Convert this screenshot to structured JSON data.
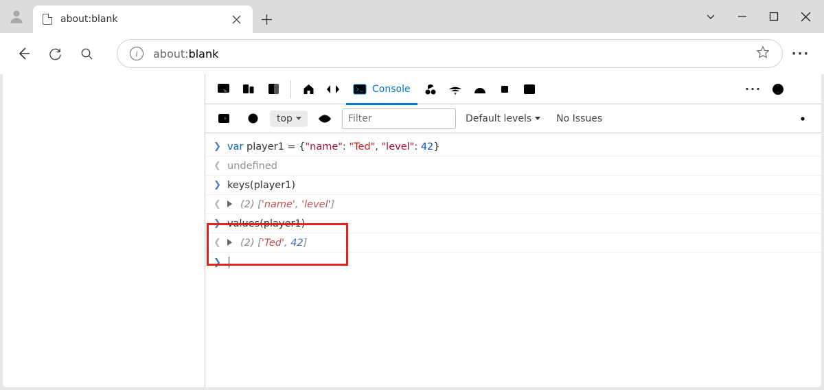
{
  "tab": {
    "title": "about:blank"
  },
  "url": {
    "prefix": "about:",
    "path": "blank"
  },
  "devtools": {
    "active_tab_label": "Console",
    "context": "top",
    "filter_placeholder": "Filter",
    "levels_label": "Default levels",
    "issues_label": "No Issues"
  },
  "console": {
    "lines": {
      "l0_var": "var",
      "l0_rest": " player1 = {",
      "l0_k1": "\"name\"",
      "l0_v1": "\"Ted\"",
      "l0_k2": "\"level\"",
      "l0_v2": "42",
      "l1": "undefined",
      "l2": "keys(player1)",
      "l3_count": "(2)",
      "l3_a": "'name'",
      "l3_b": "'level'",
      "l4": "values(player1)",
      "l5_count": "(2)",
      "l5_a": "'Ted'",
      "l5_b": "42"
    }
  }
}
